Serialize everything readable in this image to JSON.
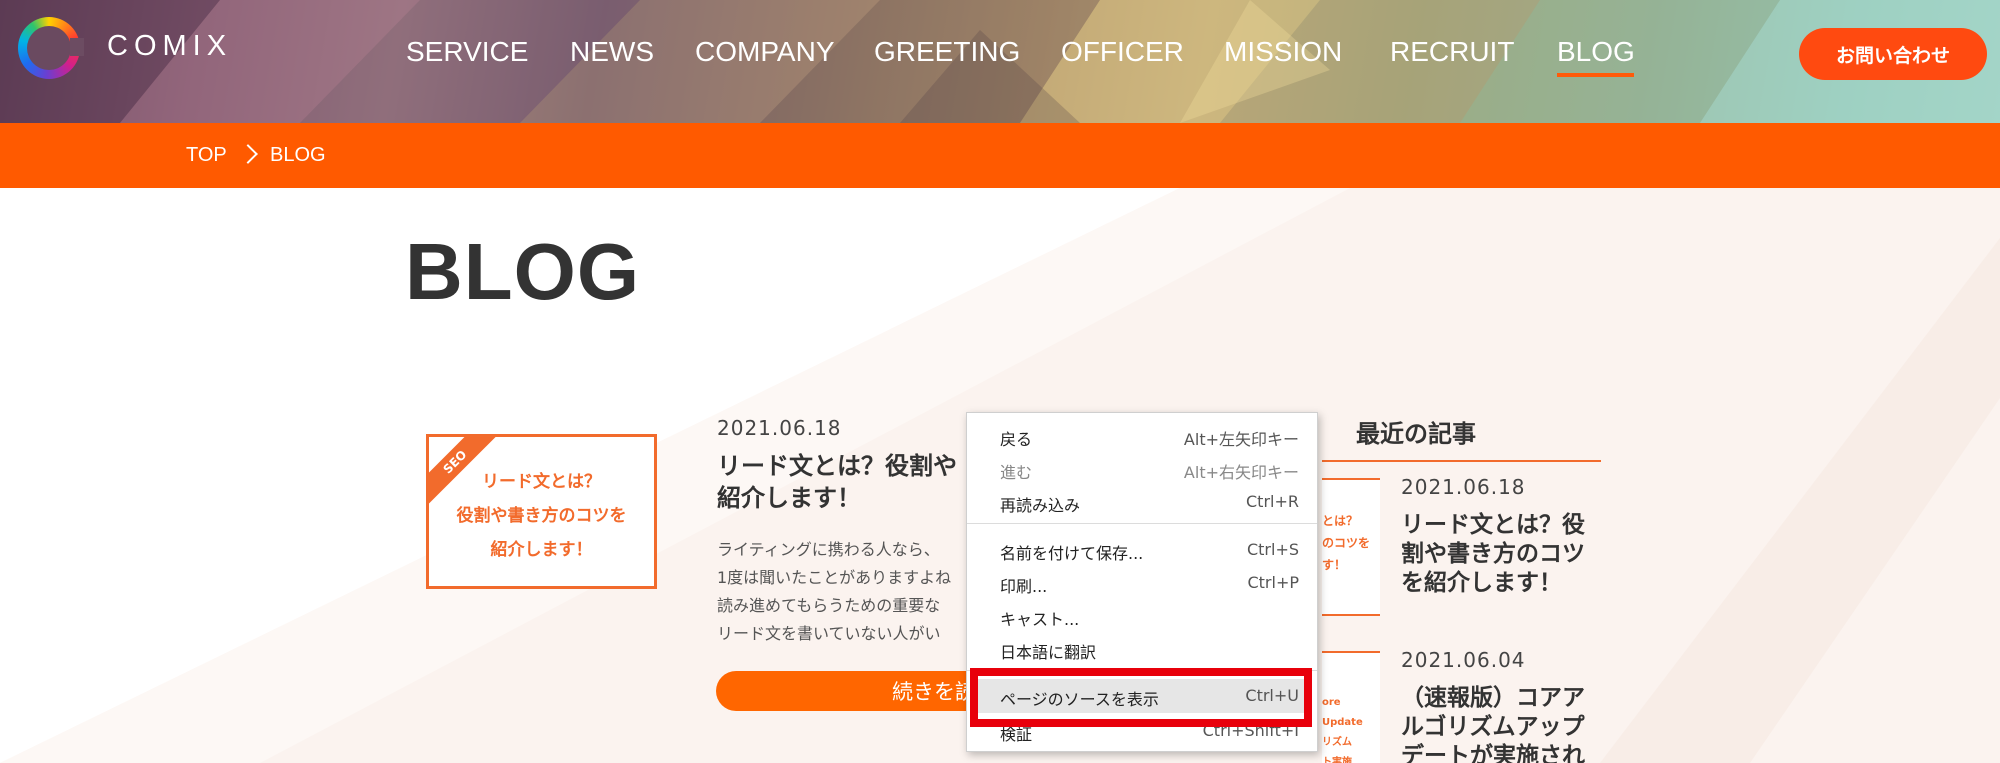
{
  "header": {
    "logo_text": "COMIX",
    "nav": [
      "SERVICE",
      "NEWS",
      "COMPANY",
      "GREETING",
      "OFFICER",
      "MISSION",
      "RECRUIT",
      "BLOG"
    ],
    "active_nav": "BLOG",
    "contact_label": "お問い合わせ"
  },
  "breadcrumb": [
    "TOP",
    "BLOG"
  ],
  "page_title": "BLOG",
  "post": {
    "thumb_badge": "SEO",
    "thumb_lines": [
      "リード文とは？",
      "役割や書き方のコツを",
      "紹介します！"
    ],
    "date": "2021.06.18",
    "title_lines": [
      "リード文とは？役割や",
      "紹介します！"
    ],
    "excerpt_lines": [
      "ライティングに携わる人なら、",
      "1度は聞いたことがありますよね",
      "読み進めてもらうための重要な",
      "リード文を書いていない人がい"
    ],
    "read_more": "続きを読"
  },
  "sidebar": {
    "title": "最近の記事",
    "items": [
      {
        "date": "2021.06.18",
        "title_lines": [
          "リード文とは？役",
          "割や書き方のコツ",
          "を紹介します！"
        ],
        "thumb_lines": [
          "とは？",
          "のコツを",
          "す！"
        ]
      },
      {
        "date": "2021.06.04",
        "title_lines": [
          "（速報版）コアア",
          "ルゴリズムアップ",
          "デートが実施され"
        ],
        "thumb_lines": [
          "ore Update",
          "リズム",
          "ト実施"
        ]
      }
    ]
  },
  "context_menu": {
    "items": [
      {
        "label": "戻る",
        "shortcut": "Alt+左矢印キー",
        "disabled": false
      },
      {
        "label": "進む",
        "shortcut": "Alt+右矢印キー",
        "disabled": true
      },
      {
        "label": "再読み込み",
        "shortcut": "Ctrl+R",
        "disabled": false
      },
      {
        "label": "名前を付けて保存...",
        "shortcut": "Ctrl+S",
        "disabled": false
      },
      {
        "label": "印刷...",
        "shortcut": "Ctrl+P",
        "disabled": false
      },
      {
        "label": "キャスト...",
        "shortcut": "",
        "disabled": false
      },
      {
        "label": "日本語に翻訳",
        "shortcut": "",
        "disabled": false
      },
      {
        "label": "ページのソースを表示",
        "shortcut": "Ctrl+U",
        "disabled": false
      },
      {
        "label": "検証",
        "shortcut": "Ctrl+Shift+I",
        "disabled": false
      }
    ],
    "highlighted": "ページのソースを表示"
  },
  "colors": {
    "accent_orange": "#ff5a00",
    "thumb_orange": "#f26b2c",
    "highlight_red": "#e8000b"
  }
}
